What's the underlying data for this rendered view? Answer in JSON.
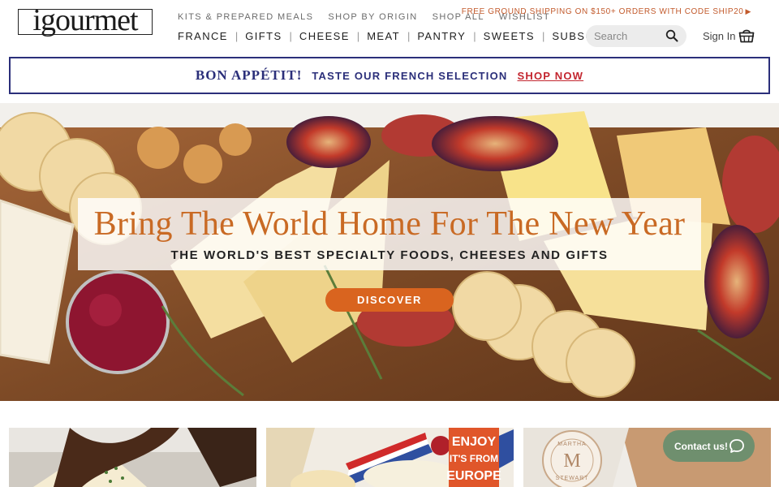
{
  "header": {
    "logo_text": "igourmet",
    "utility_nav": [
      "KITS & PREPARED MEALS",
      "SHOP BY ORIGIN",
      "SHOP ALL",
      "WISHLIST"
    ],
    "promo": "FREE GROUND SHIPPING ON $150+ ORDERS WITH CODE SHIP20",
    "main_nav": [
      "FRANCE",
      "GIFTS",
      "CHEESE",
      "MEAT",
      "PANTRY",
      "SWEETS",
      "SUBSCRIPTIONS"
    ],
    "search_placeholder": "Search",
    "signin_label": "Sign In",
    "icons": {
      "search": "search-icon",
      "cart": "basket-icon",
      "promo_arrow": "triangle-right-icon"
    }
  },
  "french_banner": {
    "headline": "BON APPÉTIT!",
    "text": "TASTE OUR FRENCH SELECTION",
    "link": "SHOP NOW",
    "colors": {
      "navy": "#2b2f7a",
      "red": "#c3262f"
    }
  },
  "hero": {
    "title": "Bring The World Home For The New Year",
    "subtitle": "THE WORLD'S BEST SPECIALTY FOODS, CHEESES AND GIFTS",
    "cta": "DISCOVER",
    "colors": {
      "title": "#c96a24",
      "cta": "#d9641f"
    }
  },
  "tiles": [
    {
      "name": "cheese-gift-box"
    },
    {
      "name": "french-cheese",
      "sign_text": "ENJOY IT'S FROM EUROPE"
    },
    {
      "name": "martha-stewart",
      "seal_text": "MARTHA STEWART",
      "seal_letter": "M"
    }
  ],
  "contact": {
    "label": "Contact us!",
    "icon": "chat-bubble-icon",
    "color": "#6f8f6e"
  }
}
